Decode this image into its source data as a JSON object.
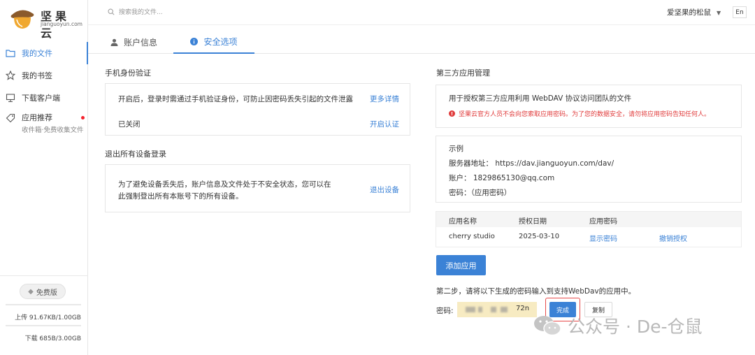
{
  "app": {
    "logo_cn": "坚果云",
    "logo_en": "jianguoyun.com"
  },
  "sidebar": {
    "items": [
      {
        "label": "我的文件",
        "icon": "folder-icon"
      },
      {
        "label": "我的书签",
        "icon": "star-icon"
      },
      {
        "label": "下载客户端",
        "icon": "monitor-icon"
      },
      {
        "label": "应用推荐",
        "sub": "收件箱·免费收集文件",
        "icon": "tag-icon"
      }
    ],
    "plan_label": "免费版",
    "upload": "上传 91.67KB/1.00GB",
    "download": "下载 685B/3.00GB"
  },
  "topbar": {
    "search_placeholder": "搜索我的文件...",
    "user_name": "爱坚果的松鼠",
    "lang": "En"
  },
  "tabs": [
    {
      "label": "账户信息",
      "active": false
    },
    {
      "label": "安全选项",
      "active": true
    }
  ],
  "phone_verify": {
    "title": "手机身份验证",
    "desc": "开启后，登录时需通过手机验证身份，可防止因密码丢失引起的文件泄露",
    "more_link": "更多详情",
    "status": "已关闭",
    "enable_link": "开启认证"
  },
  "logout_all": {
    "title": "退出所有设备登录",
    "desc_line1": "为了避免设备丢失后，账户信息及文件处于不安全状态，您可以在",
    "desc_line2": "此强制登出所有本账号下的所有设备。",
    "action_link": "退出设备"
  },
  "third_party": {
    "title": "第三方应用管理",
    "desc": "用于授权第三方应用利用 WebDAV 协议访问团队的文件",
    "warning": "坚果云官方人员不会向您索取应用密码。为了您的数据安全，请勿将应用密码告知任何人。",
    "example_title": "示例",
    "server": "服务器地址：  https://dav.jianguoyun.com/dav/",
    "account": "账户：  1829865130@qq.com",
    "password": "密码：（应用密码）",
    "table_headers": [
      "应用名称",
      "授权日期",
      "应用密码"
    ],
    "rows": [
      {
        "name": "cherry studio",
        "date": "2025-03-10",
        "show": "显示密码",
        "revoke": "撤销授权"
      }
    ],
    "add_button": "添加应用",
    "step_text": "第二步，请将以下生成的密码输入到支持WebDav的应用中。",
    "pw_label": "密码:",
    "pw_tail": "72n",
    "done_button": "完成",
    "copy_button": "复制"
  },
  "watermark": "公众号 · De-仓鼠",
  "colors": {
    "accent": "#3b82d6",
    "warning": "#e03b3b",
    "pw_highlight": "#f7ebc2"
  }
}
